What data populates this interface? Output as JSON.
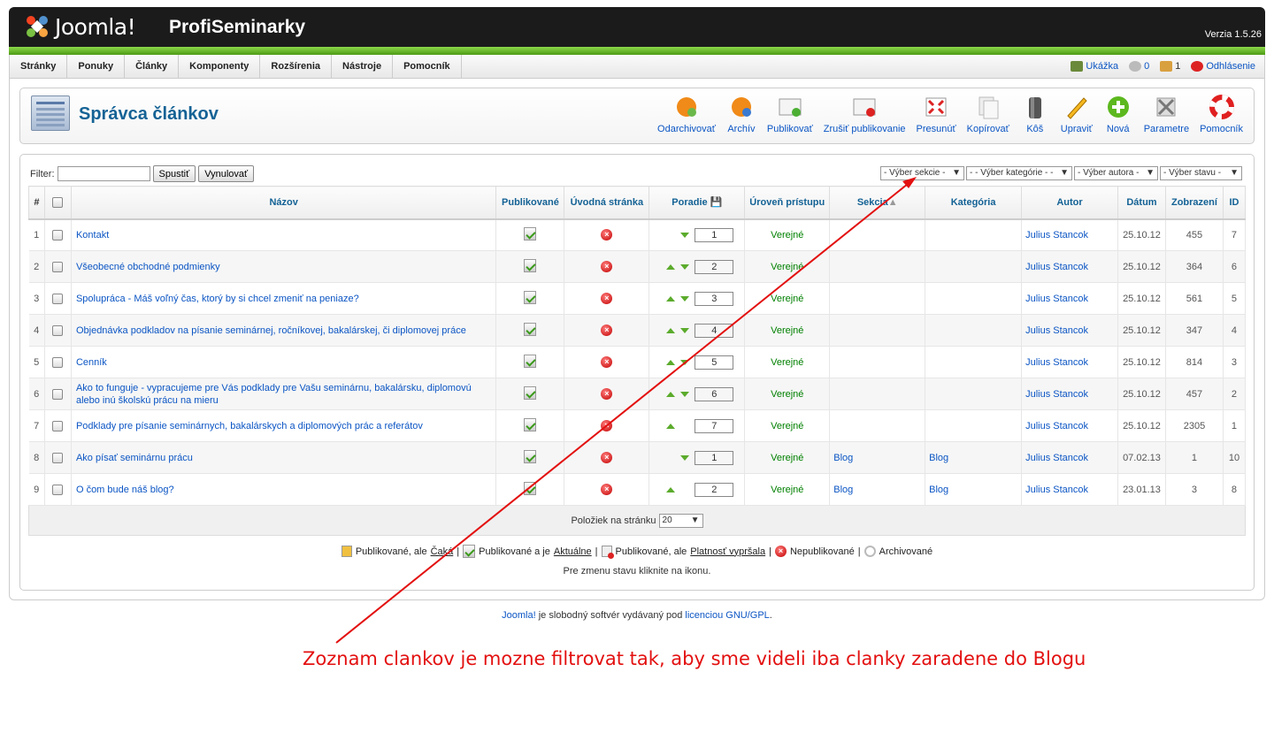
{
  "header": {
    "logo": "Joomla!",
    "site_name": "ProfiSeminarky",
    "version": "Verzia 1.5.26"
  },
  "menu": [
    "Stránky",
    "Ponuky",
    "Články",
    "Komponenty",
    "Rozšírenia",
    "Nástroje",
    "Pomocník"
  ],
  "status": {
    "preview": "Ukážka",
    "messages": "0",
    "users": "1",
    "logout": "Odhlásenie"
  },
  "page_title": "Správca článkov",
  "toolbar": [
    "Odarchivovať",
    "Archív",
    "Publikovať",
    "Zrušiť publikovanie",
    "Presunúť",
    "Kopírovať",
    "Kôš",
    "Upraviť",
    "Nová",
    "Parametre",
    "Pomocník"
  ],
  "filter": {
    "label": "Filter:",
    "value": "",
    "go": "Spustiť",
    "reset": "Vynulovať"
  },
  "selects": [
    "- Výber sekcie -",
    "- - Výber kategórie - -",
    "- Výber autora -",
    "- Výber stavu -"
  ],
  "columns": [
    "#",
    "",
    "Názov",
    "Publikované",
    "Úvodná stránka",
    "Poradie",
    "Úroveň prístupu",
    "Sekcia",
    "Kategória",
    "Autor",
    "Dátum",
    "Zobrazení",
    "ID"
  ],
  "rows": [
    {
      "n": "1",
      "title": "Kontakt",
      "up": false,
      "down": true,
      "order": "1",
      "access": "Verejné",
      "section": "",
      "category": "",
      "author": "Julius Stancok",
      "date": "25.10.12",
      "hits": "455",
      "id": "7"
    },
    {
      "n": "2",
      "title": "Všeobecné obchodné podmienky",
      "up": true,
      "down": true,
      "order": "2",
      "access": "Verejné",
      "section": "",
      "category": "",
      "author": "Julius Stancok",
      "date": "25.10.12",
      "hits": "364",
      "id": "6"
    },
    {
      "n": "3",
      "title": "Spolupráca - Máš voľný čas, ktorý by si chcel zmeniť na peniaze?",
      "up": true,
      "down": true,
      "order": "3",
      "access": "Verejné",
      "section": "",
      "category": "",
      "author": "Julius Stancok",
      "date": "25.10.12",
      "hits": "561",
      "id": "5"
    },
    {
      "n": "4",
      "title": "Objednávka podkladov na písanie seminárnej, ročníkovej, bakalárskej, či diplomovej práce",
      "up": true,
      "down": true,
      "order": "4",
      "access": "Verejné",
      "section": "",
      "category": "",
      "author": "Julius Stancok",
      "date": "25.10.12",
      "hits": "347",
      "id": "4"
    },
    {
      "n": "5",
      "title": "Cenník",
      "up": true,
      "down": true,
      "order": "5",
      "access": "Verejné",
      "section": "",
      "category": "",
      "author": "Julius Stancok",
      "date": "25.10.12",
      "hits": "814",
      "id": "3"
    },
    {
      "n": "6",
      "title": "Ako to funguje - vypracujeme pre Vás podklady pre Vašu seminárnu, bakalársku, diplomovú alebo inú školskú prácu na mieru",
      "up": true,
      "down": true,
      "order": "6",
      "access": "Verejné",
      "section": "",
      "category": "",
      "author": "Julius Stancok",
      "date": "25.10.12",
      "hits": "457",
      "id": "2"
    },
    {
      "n": "7",
      "title": "Podklady pre písanie seminárnych, bakalárskych a diplomových prác a referátov",
      "up": true,
      "down": false,
      "order": "7",
      "access": "Verejné",
      "section": "",
      "category": "",
      "author": "Julius Stancok",
      "date": "25.10.12",
      "hits": "2305",
      "id": "1"
    },
    {
      "n": "8",
      "title": "Ako písať seminárnu prácu",
      "up": false,
      "down": true,
      "order": "1",
      "access": "Verejné",
      "section": "Blog",
      "category": "Blog",
      "author": "Julius Stancok",
      "date": "07.02.13",
      "hits": "1",
      "id": "10"
    },
    {
      "n": "9",
      "title": "O čom bude náš blog?",
      "up": true,
      "down": false,
      "order": "2",
      "access": "Verejné",
      "section": "Blog",
      "category": "Blog",
      "author": "Julius Stancok",
      "date": "23.01.13",
      "hits": "3",
      "id": "8"
    }
  ],
  "pager": {
    "label": "Položiek na stránku",
    "value": "20"
  },
  "legend": {
    "pending_a": "Publikované, ale ",
    "pending_b": "Čaká",
    "current_a": "Publikované a je ",
    "current_b": "Aktuálne",
    "expired_a": "Publikované, ale ",
    "expired_b": "Platnosť vypršala",
    "unpublished": "Nepublikované",
    "archived": "Archivované",
    "sep": "|"
  },
  "hint": "Pre zmenu stavu kliknite na ikonu.",
  "footer": {
    "link1": "Joomla!",
    "text": " je slobodný softvér vydávaný pod ",
    "link2": "licenciou GNU/GPL",
    "end": "."
  },
  "annotation": "Zoznam clankov je mozne filtrovat tak, aby sme videli iba clanky zaradene do Blogu",
  "colors": {
    "header": "#1b1b1b",
    "green": "#5cb81e",
    "title": "#146295",
    "link": "#0b55c4",
    "annotation": "#e31010"
  }
}
